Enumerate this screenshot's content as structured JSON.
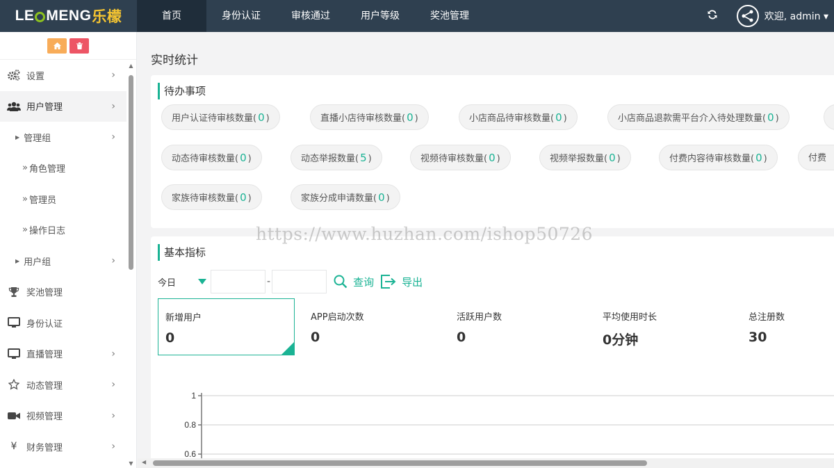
{
  "header": {
    "logo": {
      "part1": "LE",
      "part2": "MENG",
      "cn": "乐檬"
    },
    "nav": [
      "首页",
      "身份认证",
      "审核通过",
      "用户等级",
      "奖池管理"
    ],
    "active_nav": 0,
    "user_label": "欢迎, admin ▾"
  },
  "sidebar": {
    "items": [
      {
        "label": "设置",
        "icon": "gears-icon"
      },
      {
        "label": "用户管理",
        "icon": "users-icon"
      },
      {
        "label": "管理组"
      },
      {
        "label": "角色管理"
      },
      {
        "label": "管理员"
      },
      {
        "label": "操作日志"
      },
      {
        "label": "用户组"
      },
      {
        "label": "奖池管理",
        "icon": "trophy-icon"
      },
      {
        "label": "身份认证",
        "icon": "monitor-icon"
      },
      {
        "label": "直播管理",
        "icon": "monitor-icon"
      },
      {
        "label": "动态管理",
        "icon": "star-icon"
      },
      {
        "label": "视频管理",
        "icon": "video-camera-icon"
      },
      {
        "label": "财务管理",
        "icon": "yen-icon"
      }
    ]
  },
  "main": {
    "page_title": "实时统计",
    "todo": {
      "title": "待办事项",
      "pills": [
        {
          "label": "用户认证待审核数量(",
          "count": "0"
        },
        {
          "label": "直播小店待审核数量(",
          "count": "0"
        },
        {
          "label": "小店商品待审核数量(",
          "count": "0"
        },
        {
          "label": "小店商品退款需平台介入待处理数量(",
          "count": "0"
        },
        {
          "label": "动态待审核数量(",
          "count": "0"
        },
        {
          "label": "动态举报数量(",
          "count": "5"
        },
        {
          "label": "视频待审核数量(",
          "count": "0"
        },
        {
          "label": "视频举报数量(",
          "count": "0"
        },
        {
          "label": "付费内容待审核数量(",
          "count": "0"
        },
        {
          "label": "付费",
          "count": ""
        },
        {
          "label": "家族待审核数量(",
          "count": "0"
        },
        {
          "label": "家族分成申请数量(",
          "count": "0"
        }
      ]
    },
    "basic": {
      "title": "基本指标",
      "range_select": "今日",
      "date_separator": "-",
      "query_label": "查询",
      "export_label": "导出",
      "stats": [
        {
          "label": "新增用户",
          "value": "0"
        },
        {
          "label": "APP启动次数",
          "value": "0"
        },
        {
          "label": "活跃用户数",
          "value": "0"
        },
        {
          "label": "平均使用时长",
          "value": "0分钟"
        },
        {
          "label": "总注册数",
          "value": "30"
        }
      ]
    }
  },
  "watermark": "https://www.huzhan.com/ishop50726",
  "chart_data": {
    "type": "line",
    "y_ticks": [
      "1",
      "0.8",
      "0.6"
    ],
    "ylim": [
      0.6,
      1
    ],
    "grid": true
  },
  "colors": {
    "accent": "#1ab394",
    "topbar": "#2f4050",
    "home_btn": "#f8ac59",
    "delete_btn": "#ed5565"
  }
}
